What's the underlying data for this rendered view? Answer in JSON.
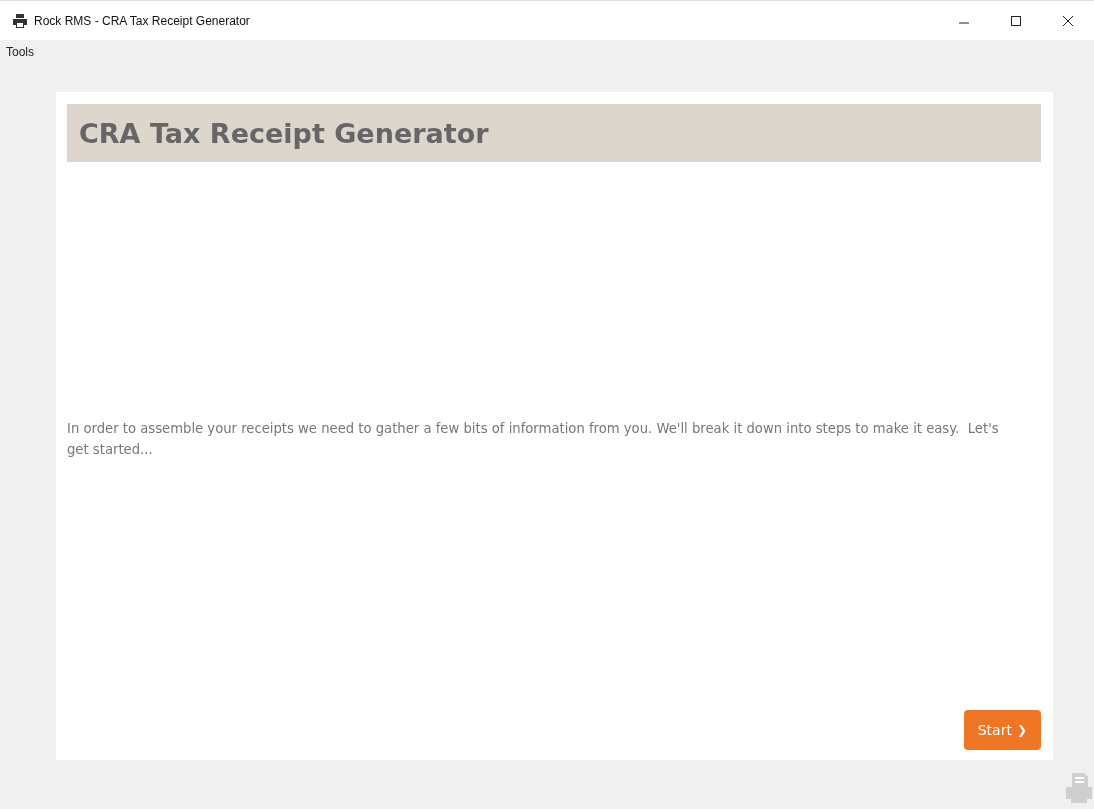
{
  "window": {
    "title": "Rock RMS - CRA Tax Receipt Generator"
  },
  "menu": [
    "Tools"
  ],
  "page": {
    "heading": "CRA Tax Receipt Generator",
    "intro": "In order to assemble your receipts we need to gather a few bits of information from you. We'll break it down into steps to make it easy.  Let's get started...",
    "button": {
      "label": "Start",
      "icon": "❯"
    }
  }
}
